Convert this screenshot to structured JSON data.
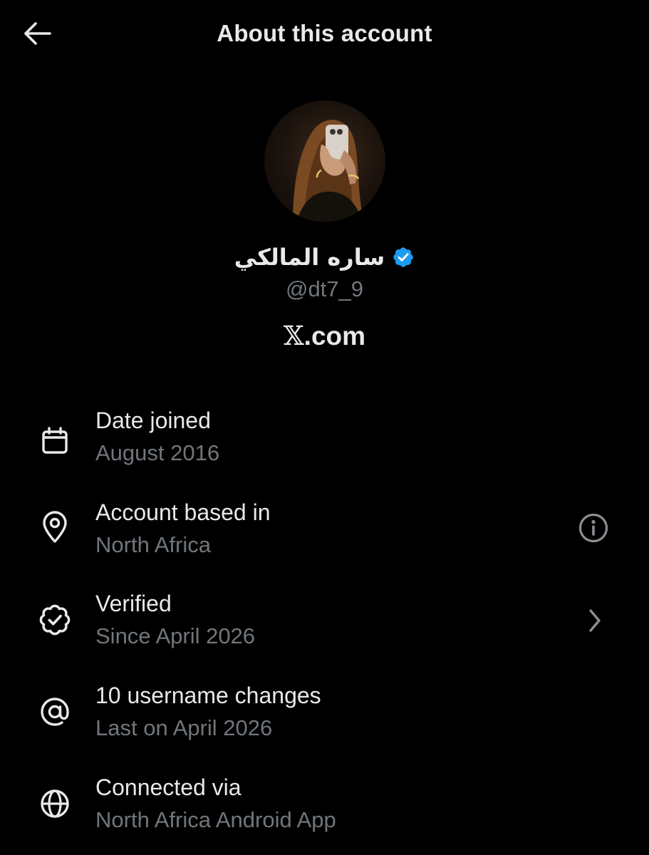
{
  "header": {
    "title": "About this account",
    "back_icon": "arrow-left-icon"
  },
  "profile": {
    "name": "ساره المالكي",
    "verified_icon": "verified-badge-icon",
    "verified_color": "#1d9bf0",
    "handle": "@dt7_9",
    "site_mark": "𝕏",
    "site_suffix": ".com"
  },
  "colors": {
    "background": "#000000",
    "primary_text": "#e7e9ea",
    "secondary_text": "#71767b"
  },
  "details": [
    {
      "icon": "calendar-icon",
      "title": "Date joined",
      "value": "August 2016",
      "action_icon": ""
    },
    {
      "icon": "location-pin-icon",
      "title": "Account based in",
      "value": "North Africa",
      "action_icon": "info-icon"
    },
    {
      "icon": "verified-badge-outline-icon",
      "title": "Verified",
      "value": "Since April 2026",
      "action_icon": "chevron-right-icon"
    },
    {
      "icon": "at-sign-icon",
      "title": "10 username changes",
      "value": "Last on April 2026",
      "action_icon": ""
    },
    {
      "icon": "globe-icon",
      "title": "Connected via",
      "value": "North Africa Android App",
      "action_icon": ""
    }
  ]
}
